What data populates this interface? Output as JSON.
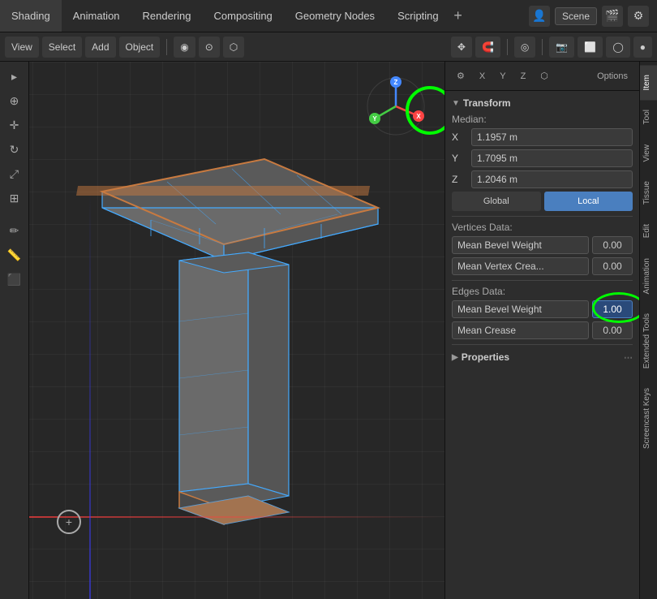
{
  "menubar": {
    "items": [
      {
        "label": "Shading",
        "id": "shading"
      },
      {
        "label": "Animation",
        "id": "animation"
      },
      {
        "label": "Rendering",
        "id": "rendering"
      },
      {
        "label": "Compositing",
        "id": "compositing"
      },
      {
        "label": "Geometry Nodes",
        "id": "geometry-nodes"
      },
      {
        "label": "Scripting",
        "id": "scripting"
      }
    ],
    "plus_label": "+",
    "scene_label": "Scene"
  },
  "second_toolbar": {
    "view_label": "View",
    "select_label": "Select",
    "add_label": "Add",
    "object_label": "Object"
  },
  "viewport": {
    "gizmo": {
      "x_label": "X",
      "y_label": "Y",
      "z_label": "Z",
      "options_label": "Options"
    }
  },
  "right_panel": {
    "toolbar": {
      "x_label": "X",
      "y_label": "Y",
      "z_label": "Z",
      "options_label": "Options"
    },
    "transform": {
      "section_label": "Transform",
      "median_label": "Median:",
      "x_value": "1.1957 m",
      "y_value": "1.7095 m",
      "z_value": "1.2046 m",
      "global_label": "Global",
      "local_label": "Local"
    },
    "vertices_data": {
      "section_label": "Vertices Data:",
      "mean_bevel_weight_label": "Mean Bevel Weight",
      "mean_bevel_weight_value": "0.00",
      "mean_vertex_crease_label": "Mean Vertex Crea...",
      "mean_vertex_crease_value": "0.00"
    },
    "edges_data": {
      "section_label": "Edges Data:",
      "mean_bevel_weight_label": "Mean Bevel Weight",
      "mean_bevel_weight_value": "1.00",
      "mean_crease_label": "Mean Crease",
      "mean_crease_value": "0.00"
    },
    "properties": {
      "section_label": "Properties"
    },
    "tabs": [
      {
        "label": "Item",
        "active": true
      },
      {
        "label": "Tool"
      },
      {
        "label": "View"
      },
      {
        "label": "Tissue"
      },
      {
        "label": "Edit"
      },
      {
        "label": "Animation"
      },
      {
        "label": "Extended Tools"
      },
      {
        "label": "Screencast Keys"
      }
    ]
  }
}
